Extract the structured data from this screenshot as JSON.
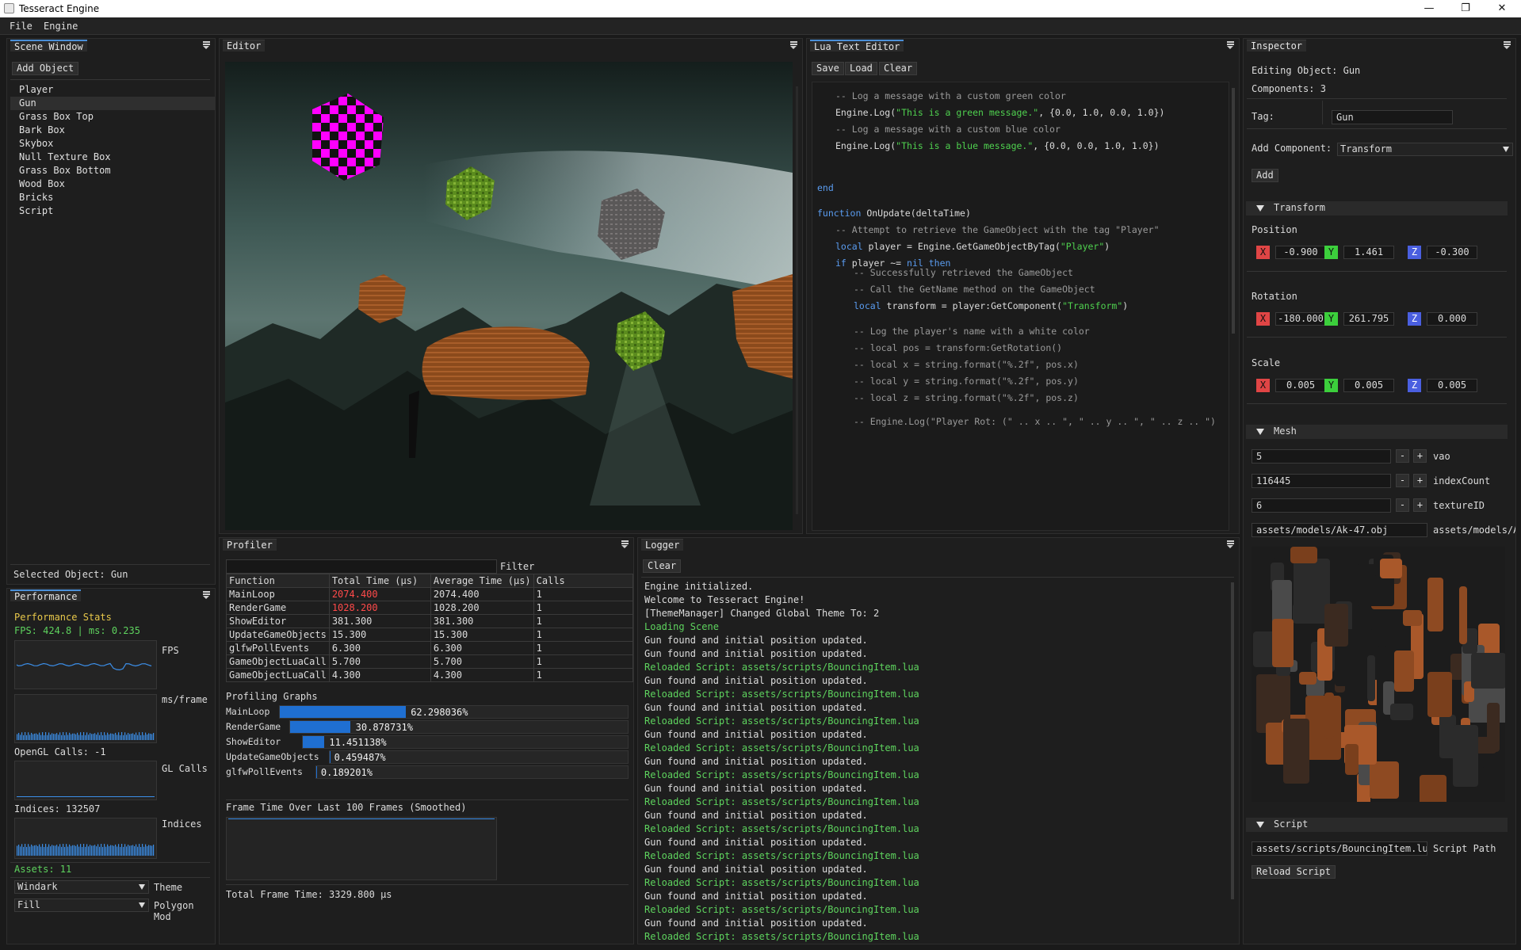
{
  "window": {
    "title": "Tesseract Engine",
    "minimize": "—",
    "maximize": "❐",
    "close": "✕"
  },
  "menu": [
    "File",
    "Engine"
  ],
  "scene_window": {
    "title": "Scene Window",
    "add_object": "Add Object",
    "objects": [
      "Player",
      "Gun",
      "Grass Box Top",
      "Bark Box",
      "Skybox",
      "Null Texture Box",
      "Grass Box Bottom",
      "Wood Box",
      "Bricks",
      "Script"
    ],
    "selected_index": 1,
    "selected_label": "Selected Object: Gun"
  },
  "performance": {
    "title": "Performance",
    "heading": "Performance Stats",
    "fps_line": "FPS: 424.8 | ms: 0.235",
    "fps_label": "FPS",
    "ms_label": "ms/frame",
    "gl_calls_line": "OpenGL Calls: -1",
    "gl_calls_label": "GL Calls",
    "indices_line": "Indices: 132507",
    "indices_label": "Indices",
    "assets_line": "Assets: 11",
    "theme_value": "Windark",
    "theme_label": "Theme",
    "polygon_value": "Fill",
    "polygon_label": "Polygon Mod"
  },
  "editor": {
    "title": "Editor"
  },
  "lua_editor": {
    "title": "Lua Text Editor",
    "save": "Save",
    "load": "Load",
    "clear": "Clear",
    "lines": [
      {
        "indent": 1,
        "parts": [
          {
            "t": "-- Log a message with a custom green color",
            "c": "cm"
          }
        ]
      },
      {
        "indent": 1,
        "parts": [
          {
            "t": "Engine.Log(",
            "c": ""
          },
          {
            "t": "\"This is a green message.\"",
            "c": "str"
          },
          {
            "t": ", {0.0, 1.0, 0.0, 1.0})",
            "c": ""
          }
        ]
      },
      {
        "indent": 1,
        "parts": [
          {
            "t": "-- Log a message with a custom blue color",
            "c": "cm"
          }
        ]
      },
      {
        "indent": 1,
        "parts": [
          {
            "t": "Engine.Log(",
            "c": ""
          },
          {
            "t": "\"This is a blue message.\"",
            "c": "str"
          },
          {
            "t": ", {0.0, 0.0, 1.0, 1.0})",
            "c": ""
          }
        ]
      },
      {
        "indent": 0,
        "parts": [
          {
            "t": "end",
            "c": "kw"
          }
        ]
      },
      {
        "indent": 0,
        "parts": [
          {
            "t": "function",
            "c": "kw"
          },
          {
            "t": " OnUpdate(deltaTime)",
            "c": ""
          }
        ]
      },
      {
        "indent": 1,
        "parts": [
          {
            "t": "-- Attempt to retrieve the GameObject with the tag \"Player\"",
            "c": "cm"
          }
        ]
      },
      {
        "indent": 1,
        "parts": [
          {
            "t": "local",
            "c": "kw"
          },
          {
            "t": " player = Engine.GetGameObjectByTag(",
            "c": ""
          },
          {
            "t": "\"Player\"",
            "c": "str"
          },
          {
            "t": ")",
            "c": ""
          }
        ]
      },
      {
        "indent": 1,
        "parts": [
          {
            "t": "if",
            "c": "kw"
          },
          {
            "t": " player ~= ",
            "c": ""
          },
          {
            "t": "nil then",
            "c": "kw"
          }
        ]
      },
      {
        "indent": 2,
        "parts": [
          {
            "t": "-- Successfully retrieved the GameObject",
            "c": "cm"
          }
        ]
      },
      {
        "indent": 2,
        "parts": [
          {
            "t": "-- Call the GetName method on the GameObject",
            "c": "cm"
          }
        ]
      },
      {
        "indent": 2,
        "parts": [
          {
            "t": "local",
            "c": "kw"
          },
          {
            "t": " transform = player:GetComponent(",
            "c": ""
          },
          {
            "t": "\"Transform\"",
            "c": "str"
          },
          {
            "t": ")",
            "c": ""
          }
        ]
      },
      {
        "indent": 2,
        "parts": [
          {
            "t": "-- Log the player's name with a white color",
            "c": "cm"
          }
        ]
      },
      {
        "indent": 2,
        "parts": [
          {
            "t": "-- local pos = transform:GetRotation()",
            "c": "cm"
          }
        ]
      },
      {
        "indent": 2,
        "parts": [
          {
            "t": "-- local x = string.format(\"%.2f\", pos.x)",
            "c": "cm"
          }
        ]
      },
      {
        "indent": 2,
        "parts": [
          {
            "t": "-- local y = string.format(\"%.2f\", pos.y)",
            "c": "cm"
          }
        ]
      },
      {
        "indent": 2,
        "parts": [
          {
            "t": "-- local z = string.format(\"%.2f\", pos.z)",
            "c": "cm"
          }
        ]
      },
      {
        "indent": 2,
        "parts": [
          {
            "t": "-- Engine.Log(\"Player Rot: (\" .. x .. \", \" .. y .. \", \" .. z .. \")",
            "c": "cm"
          }
        ]
      }
    ]
  },
  "profiler": {
    "title": "Profiler",
    "filter_label": "Filter",
    "columns": [
      "Function",
      "Total Time (µs)",
      "Average Time (µs)",
      "Calls"
    ],
    "rows": [
      {
        "fn": "MainLoop",
        "total": "2074.400",
        "avg": "2074.400",
        "calls": "1",
        "hot": true
      },
      {
        "fn": "RenderGame",
        "total": "1028.200",
        "avg": "1028.200",
        "calls": "1",
        "hot": true
      },
      {
        "fn": "ShowEditor",
        "total": "381.300",
        "avg": "381.300",
        "calls": "1",
        "hot": false
      },
      {
        "fn": "UpdateGameObjects",
        "total": "15.300",
        "avg": "15.300",
        "calls": "1",
        "hot": false
      },
      {
        "fn": "glfwPollEvents",
        "total": "6.300",
        "avg": "6.300",
        "calls": "1",
        "hot": false
      },
      {
        "fn": "GameObjectLuaCall",
        "total": "5.700",
        "avg": "5.700",
        "calls": "1",
        "hot": false
      },
      {
        "fn": "GameObjectLuaCall",
        "total": "4.300",
        "avg": "4.300",
        "calls": "1",
        "hot": false
      }
    ],
    "graphs_title": "Profiling Graphs",
    "bars": [
      {
        "name": "MainLoop",
        "percent": 62.298036,
        "label": "62.298036%"
      },
      {
        "name": "RenderGame",
        "percent": 30.878731,
        "label": "30.878731%"
      },
      {
        "name": "ShowEditor",
        "percent": 11.451138,
        "label": "11.451138%"
      },
      {
        "name": "UpdateGameObjects",
        "percent": 0.459487,
        "label": "0.459487%"
      },
      {
        "name": "glfwPollEvents",
        "percent": 0.189201,
        "label": "0.189201%"
      }
    ],
    "frame_time_title": "Frame Time Over Last 100 Frames (Smoothed)",
    "total_frame_time": "Total Frame Time: 3329.800 µs"
  },
  "logger": {
    "title": "Logger",
    "clear": "Clear",
    "lines": [
      {
        "t": "Engine initialized.",
        "g": false
      },
      {
        "t": "Welcome to Tesseract Engine!",
        "g": false
      },
      {
        "t": "[ThemeManager] Changed Global Theme To: 2",
        "g": false
      },
      {
        "t": "Loading Scene",
        "g": true
      },
      {
        "t": "Gun found and initial position updated.",
        "g": false
      },
      {
        "t": "Gun found and initial position updated.",
        "g": false
      },
      {
        "t": "Reloaded Script: assets/scripts/BouncingItem.lua",
        "g": true
      },
      {
        "t": "Gun found and initial position updated.",
        "g": false
      },
      {
        "t": "Reloaded Script: assets/scripts/BouncingItem.lua",
        "g": true
      },
      {
        "t": "Gun found and initial position updated.",
        "g": false
      },
      {
        "t": "Reloaded Script: assets/scripts/BouncingItem.lua",
        "g": true
      },
      {
        "t": "Gun found and initial position updated.",
        "g": false
      },
      {
        "t": "Reloaded Script: assets/scripts/BouncingItem.lua",
        "g": true
      },
      {
        "t": "Gun found and initial position updated.",
        "g": false
      },
      {
        "t": "Reloaded Script: assets/scripts/BouncingItem.lua",
        "g": true
      },
      {
        "t": "Gun found and initial position updated.",
        "g": false
      },
      {
        "t": "Reloaded Script: assets/scripts/BouncingItem.lua",
        "g": true
      },
      {
        "t": "Gun found and initial position updated.",
        "g": false
      },
      {
        "t": "Reloaded Script: assets/scripts/BouncingItem.lua",
        "g": true
      },
      {
        "t": "Gun found and initial position updated.",
        "g": false
      },
      {
        "t": "Reloaded Script: assets/scripts/BouncingItem.lua",
        "g": true
      },
      {
        "t": "Gun found and initial position updated.",
        "g": false
      },
      {
        "t": "Reloaded Script: assets/scripts/BouncingItem.lua",
        "g": true
      },
      {
        "t": "Gun found and initial position updated.",
        "g": false
      },
      {
        "t": "Reloaded Script: assets/scripts/BouncingItem.lua",
        "g": true
      },
      {
        "t": "Gun found and initial position updated.",
        "g": false
      },
      {
        "t": "Reloaded Script: assets/scripts/BouncingItem.lua",
        "g": true
      }
    ]
  },
  "inspector": {
    "title": "Inspector",
    "editing": "Editing Object: Gun",
    "components": "Components: 3",
    "tag_label": "Tag:",
    "tag_value": "Gun",
    "add_component_label": "Add Component:",
    "add_component_value": "Transform",
    "add_button": "Add",
    "transform": {
      "header": "Transform",
      "position_label": "Position",
      "position": [
        "-0.900",
        "1.461",
        "-0.300"
      ],
      "rotation_label": "Rotation",
      "rotation": [
        "-180.000",
        "261.795",
        "0.000"
      ],
      "scale_label": "Scale",
      "scale": [
        "0.005",
        "0.005",
        "0.005"
      ],
      "axis": [
        "X",
        "Y",
        "Z"
      ]
    },
    "mesh": {
      "header": "Mesh",
      "fields": [
        {
          "value": "5",
          "label": "vao"
        },
        {
          "value": "116445",
          "label": "indexCount"
        },
        {
          "value": "6",
          "label": "textureID"
        }
      ],
      "minus": "-",
      "plus": "+",
      "path_value": "assets/models/Ak-47.obj",
      "path_label": "assets/models/A"
    },
    "script": {
      "header": "Script",
      "path_value": "assets/scripts/BouncingItem.lua",
      "path_label": "Script Path",
      "reload": "Reload Script"
    }
  },
  "colors": {
    "accent": "#1f6fd1",
    "green_text": "#5ed35e",
    "hot_value": "#ff4a4a",
    "magenta": "#ff00ff"
  }
}
